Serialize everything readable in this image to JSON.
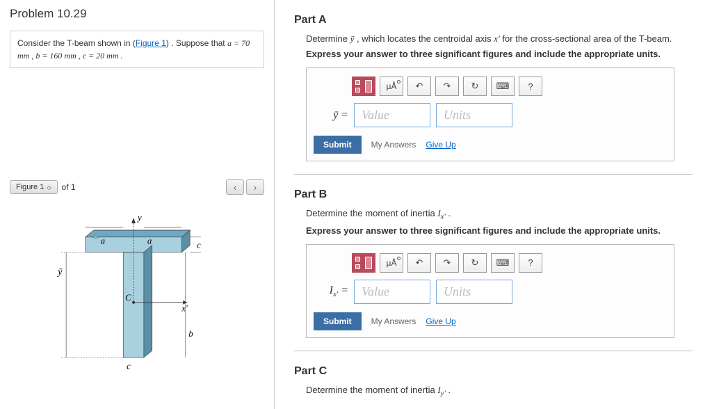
{
  "problem": {
    "title": "Problem 10.29",
    "description_pre": "Consider the T-beam shown in (",
    "figure_link": "Figure 1",
    "description_post": ") . Suppose that ",
    "vars": "a = 70 mm , b = 160 mm , c = 20 mm ."
  },
  "figure_nav": {
    "select_label": "Figure 1",
    "of_label": "of 1"
  },
  "figure_labels": {
    "a": "a",
    "b": "b",
    "c": "c",
    "y": "y",
    "x": "x'",
    "ybar": "ȳ",
    "ctop": "C"
  },
  "parts": {
    "a": {
      "title": "Part A",
      "prompt_pre": "Determine ",
      "prompt_sym": "ȳ",
      "prompt_mid": " , which locates the centroidal axis ",
      "prompt_sym2": "x'",
      "prompt_post": " for the cross-sectional area of the T-beam.",
      "instruct": "Express your answer to three significant figures and include the appropriate units.",
      "lhs": "ȳ ="
    },
    "b": {
      "title": "Part B",
      "prompt_pre": "Determine the moment of inertia ",
      "prompt_sym": "I",
      "prompt_sub": "x'",
      "prompt_post": " .",
      "instruct": "Express your answer to three significant figures and include the appropriate units.",
      "lhs": "Iₓ' ="
    },
    "c": {
      "title": "Part C",
      "prompt_pre": "Determine the moment of inertia ",
      "prompt_sym": "I",
      "prompt_sub": "y'",
      "prompt_post": " ."
    }
  },
  "toolbar": {
    "mu": "μÅ",
    "undo": "↶",
    "redo": "↷",
    "reset": "↻",
    "help": "?"
  },
  "inputs": {
    "value_placeholder": "Value",
    "units_placeholder": "Units"
  },
  "buttons": {
    "submit": "Submit",
    "my_answers": "My Answers",
    "give_up": "Give Up"
  }
}
